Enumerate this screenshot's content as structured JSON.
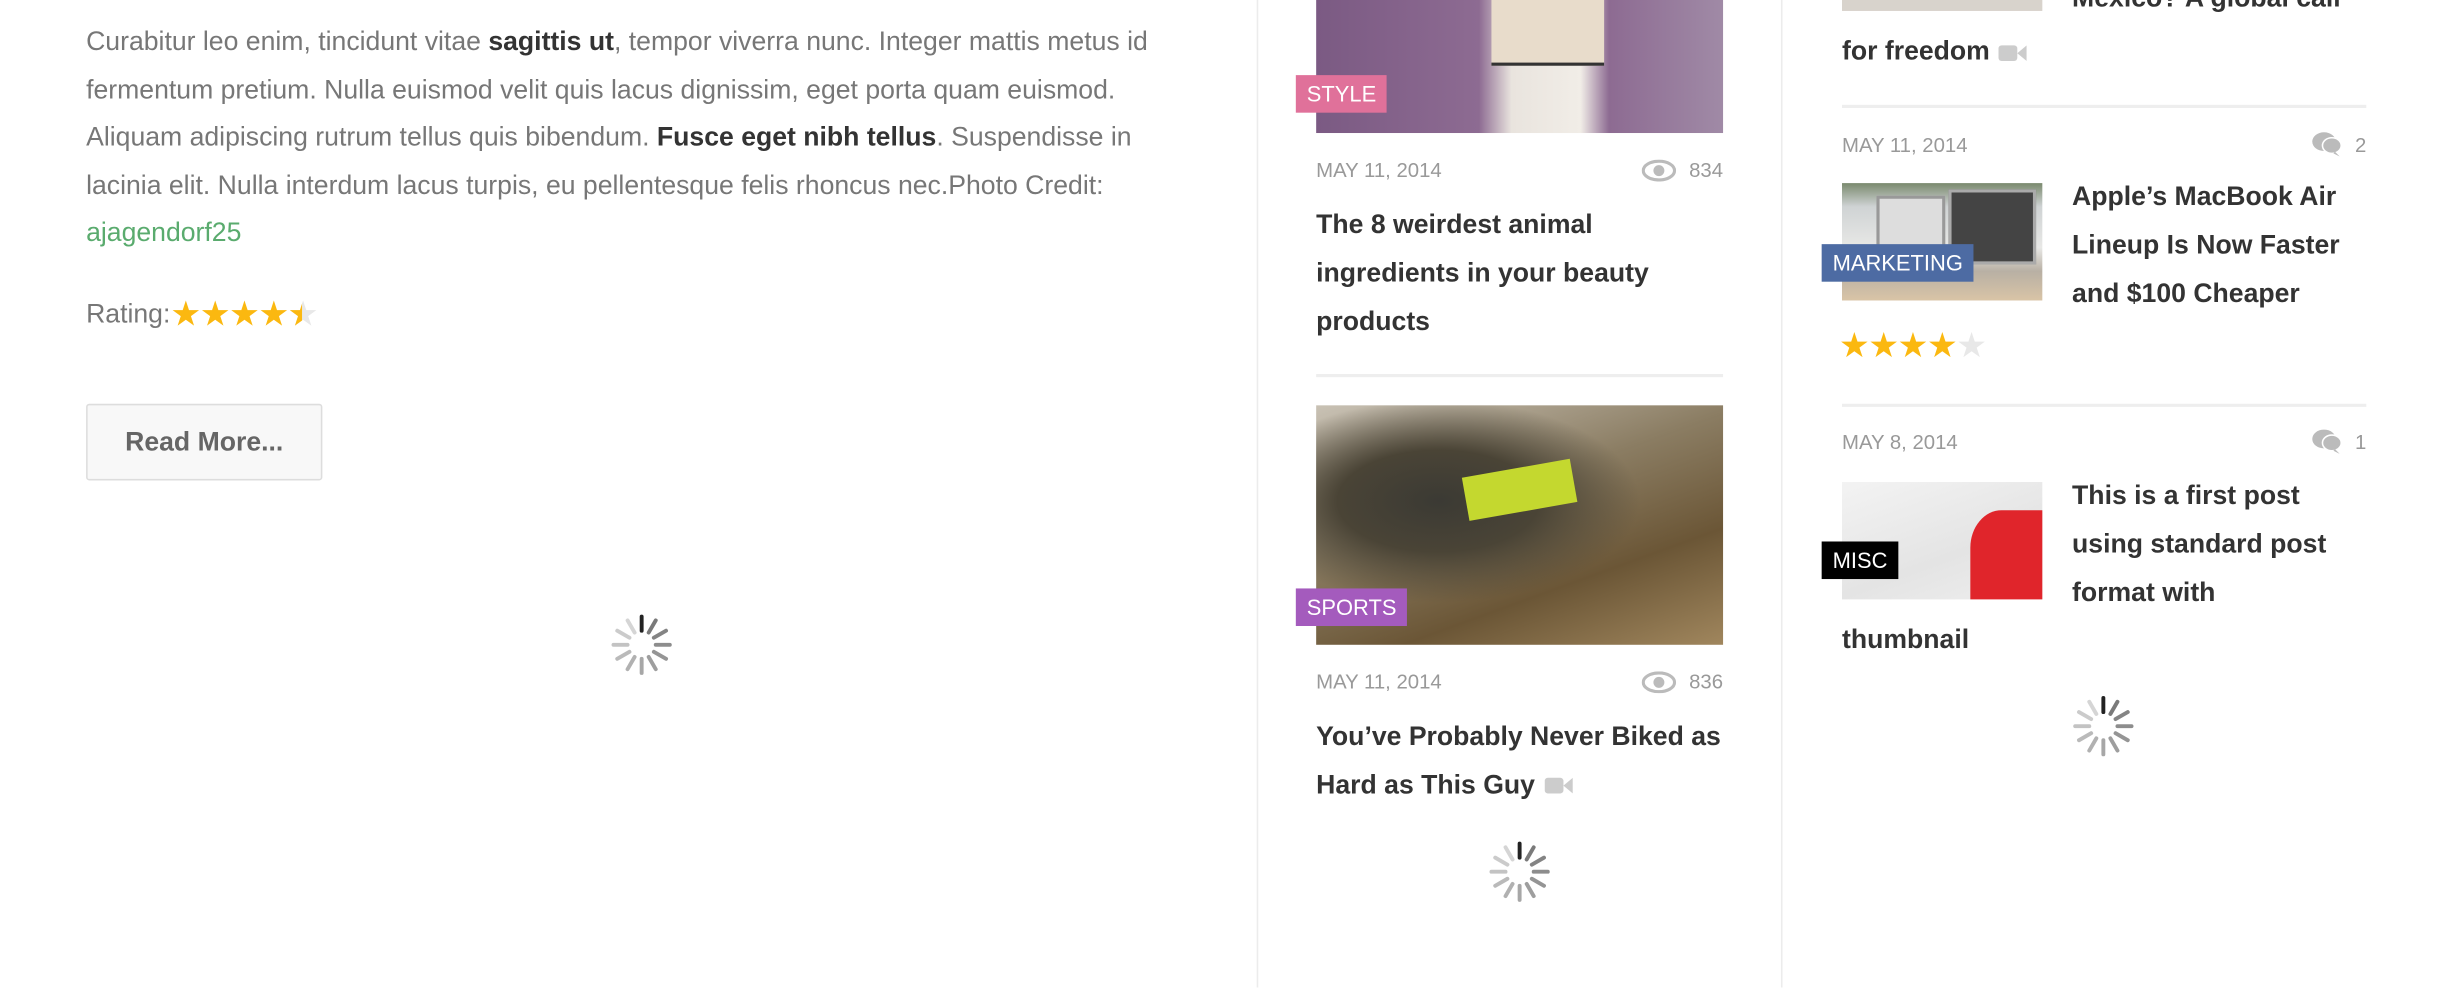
{
  "article": {
    "p1": "Curabitur leo enim, tincidunt vitae ",
    "b1": "sagittis ut",
    "p2": ", tempor viverra nunc. Integer mattis metus id fermentum pretium. Nulla euismod velit quis lacus dignissim, eget porta quam euismod. Aliquam adipiscing rutrum tellus quis bibendum. ",
    "b2": "Fusce eget nibh tellus",
    "p3": ". Suspendisse in lacinia elit. Nulla interdum lacus turpis, eu pellentesque felis rhoncus nec.Photo Credit: ",
    "link": "ajagendorf25",
    "rating_label": "Rating:",
    "rating_value": 4.5,
    "read_more": "Read More..."
  },
  "middle": {
    "posts": [
      {
        "category": "STYLE",
        "category_color": "#e0719a",
        "date": "MAY 11, 2014",
        "views": "834",
        "title": "The 8 weirdest animal ingredients in your beauty products"
      },
      {
        "category": "SPORTS",
        "category_color": "#a45bbd",
        "date": "MAY 11, 2014",
        "views": "836",
        "title": "You’ve Probably Never Biked as Hard as This Guy",
        "video": true
      }
    ]
  },
  "right": {
    "top_title_partial": "Mexico? A global call",
    "top_title_end": "for freedom",
    "posts": [
      {
        "category": "MARKETING",
        "category_color": "#4d6ba3",
        "date": "MAY 11, 2014",
        "comments": "2",
        "title": "Apple’s MacBook Air Lineup Is Now Faster and $100 Cheaper",
        "rating": 4
      },
      {
        "category": "MISC",
        "category_color": "#000000",
        "date": "MAY 8, 2014",
        "comments": "1",
        "title_a": "This is a first post using standard post format with",
        "title_b": "thumbnail"
      }
    ]
  },
  "colors": {
    "accent_star": "#fbb810",
    "link": "#5aab6e"
  }
}
